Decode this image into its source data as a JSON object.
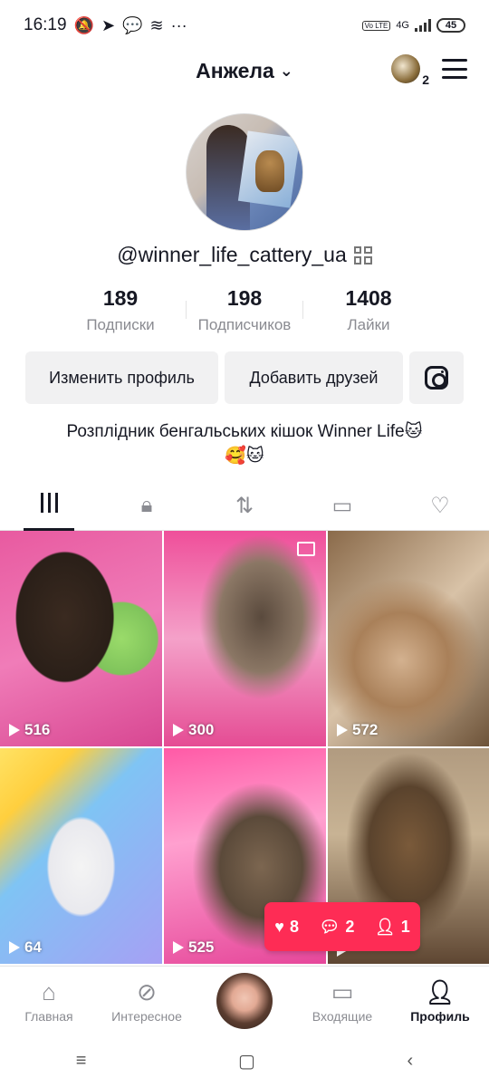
{
  "status": {
    "time": "16:19",
    "network": "4G",
    "volte": "Vo LTE",
    "battery": "45"
  },
  "header": {
    "title": "Анжела",
    "notif_badge": "2"
  },
  "profile": {
    "handle": "@winner_life_cattery_ua",
    "stats": [
      {
        "value": "189",
        "label": "Подписки"
      },
      {
        "value": "198",
        "label": "Подписчиков"
      },
      {
        "value": "1408",
        "label": "Лайки"
      }
    ],
    "edit_label": "Изменить профиль",
    "add_friends_label": "Добавить друзей",
    "bio_line1": "Розплідник бенгальських кішок Winner Life🐱",
    "bio_line2": "🥰🐱"
  },
  "tabs": [
    "videos-icon",
    "lock-icon",
    "repost-icon",
    "favorites-icon",
    "liked-icon"
  ],
  "videos": [
    {
      "views": "516"
    },
    {
      "views": "300"
    },
    {
      "views": "572"
    },
    {
      "views": "64"
    },
    {
      "views": "525"
    },
    {
      "views": ""
    }
  ],
  "notification": {
    "likes": "8",
    "comments": "2",
    "followers": "1"
  },
  "nav": {
    "home": "Главная",
    "discover": "Интересное",
    "inbox": "Входящие",
    "profile": "Профиль"
  }
}
